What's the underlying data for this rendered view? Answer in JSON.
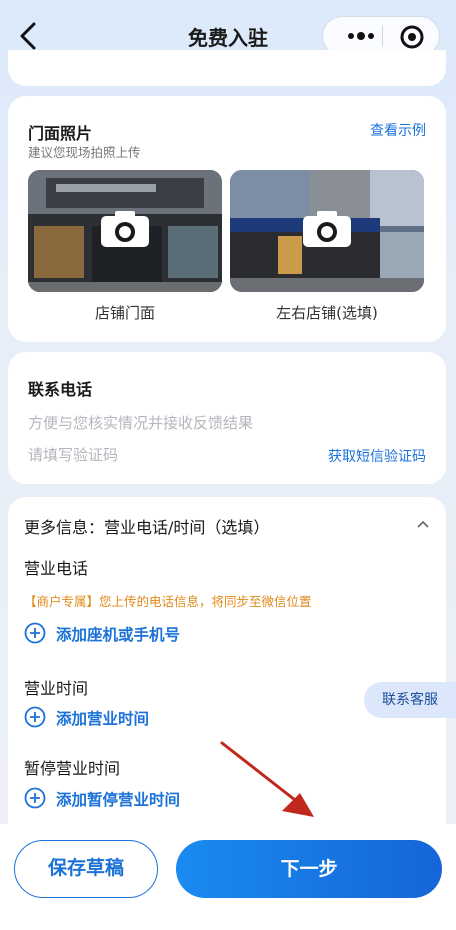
{
  "header": {
    "title": "免费入驻"
  },
  "photos": {
    "title": "门面照片",
    "subtitle": "建议您现场拍照上传",
    "example_link": "查看示例",
    "items": [
      {
        "caption": "店铺门面"
      },
      {
        "caption": "左右店铺(选填)"
      }
    ]
  },
  "contact": {
    "title": "联系电话",
    "phone_placeholder": "方便与您核实情况并接收反馈结果",
    "code_placeholder": "请填写验证码",
    "get_code": "获取短信验证码"
  },
  "more_info": {
    "header": "更多信息：营业电话/时间（选填）",
    "phone_label": "营业电话",
    "notice": "【商户专属】您上传的电话信息，将同步至微信位置",
    "add_phone": "添加座机或手机号",
    "hours_label": "营业时间",
    "add_hours": "添加营业时间",
    "pause_label": "暂停营业时间",
    "add_pause": "添加暂停营业时间"
  },
  "service_button": "联系客服",
  "footer": {
    "save": "保存草稿",
    "next": "下一步"
  },
  "colors": {
    "accent": "#1b72d8",
    "notice": "#e08a18",
    "annotation_arrow": "#c0281e"
  }
}
